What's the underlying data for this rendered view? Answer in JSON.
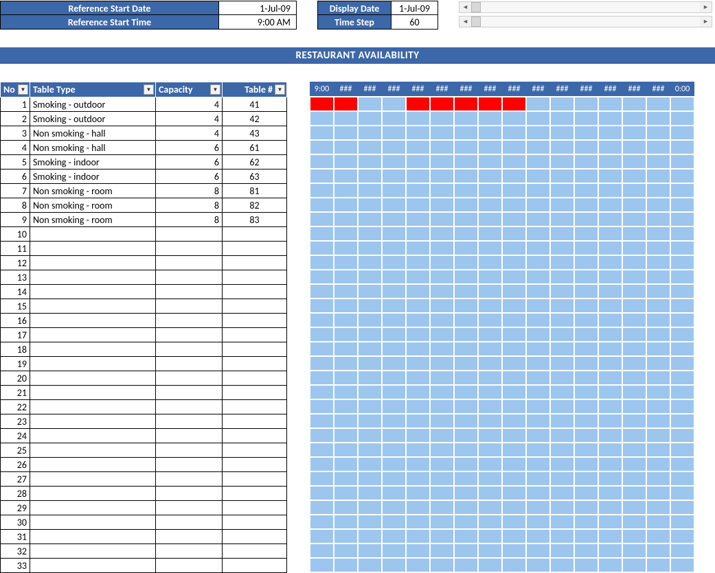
{
  "header": {
    "ref_start_date_label": "Reference Start Date",
    "ref_start_date_value": "1-Jul-09",
    "ref_start_time_label": "Reference Start Time",
    "ref_start_time_value": "9:00 AM",
    "display_date_label": "Display Date",
    "display_date_value": "1-Jul-09",
    "time_step_label": "Time Step",
    "time_step_value": "60"
  },
  "title": "RESTAURANT AVAILABILITY",
  "table": {
    "headers": {
      "no": "No",
      "table_type": "Table Type",
      "capacity": "Capacity",
      "table_num": "Table #"
    },
    "rows": [
      {
        "no": "1",
        "type": "Smoking - outdoor",
        "cap": "4",
        "num": "41"
      },
      {
        "no": "2",
        "type": "Smoking - outdoor",
        "cap": "4",
        "num": "42"
      },
      {
        "no": "3",
        "type": "Non smoking - hall",
        "cap": "4",
        "num": "43"
      },
      {
        "no": "4",
        "type": "Non smoking - hall",
        "cap": "6",
        "num": "61"
      },
      {
        "no": "5",
        "type": "Smoking - indoor",
        "cap": "6",
        "num": "62"
      },
      {
        "no": "6",
        "type": "Smoking - indoor",
        "cap": "6",
        "num": "63"
      },
      {
        "no": "7",
        "type": "Non smoking - room",
        "cap": "8",
        "num": "81"
      },
      {
        "no": "8",
        "type": "Non smoking - room",
        "cap": "8",
        "num": "82"
      },
      {
        "no": "9",
        "type": "Non smoking - room",
        "cap": "8",
        "num": "83"
      },
      {
        "no": "10",
        "type": "",
        "cap": "",
        "num": ""
      },
      {
        "no": "11",
        "type": "",
        "cap": "",
        "num": ""
      },
      {
        "no": "12",
        "type": "",
        "cap": "",
        "num": ""
      },
      {
        "no": "13",
        "type": "",
        "cap": "",
        "num": ""
      },
      {
        "no": "14",
        "type": "",
        "cap": "",
        "num": ""
      },
      {
        "no": "15",
        "type": "",
        "cap": "",
        "num": ""
      },
      {
        "no": "16",
        "type": "",
        "cap": "",
        "num": ""
      },
      {
        "no": "17",
        "type": "",
        "cap": "",
        "num": ""
      },
      {
        "no": "18",
        "type": "",
        "cap": "",
        "num": ""
      },
      {
        "no": "19",
        "type": "",
        "cap": "",
        "num": ""
      },
      {
        "no": "20",
        "type": "",
        "cap": "",
        "num": ""
      },
      {
        "no": "21",
        "type": "",
        "cap": "",
        "num": ""
      },
      {
        "no": "22",
        "type": "",
        "cap": "",
        "num": ""
      },
      {
        "no": "23",
        "type": "",
        "cap": "",
        "num": ""
      },
      {
        "no": "24",
        "type": "",
        "cap": "",
        "num": ""
      },
      {
        "no": "25",
        "type": "",
        "cap": "",
        "num": ""
      },
      {
        "no": "26",
        "type": "",
        "cap": "",
        "num": ""
      },
      {
        "no": "27",
        "type": "",
        "cap": "",
        "num": ""
      },
      {
        "no": "28",
        "type": "",
        "cap": "",
        "num": ""
      },
      {
        "no": "29",
        "type": "",
        "cap": "",
        "num": ""
      },
      {
        "no": "30",
        "type": "",
        "cap": "",
        "num": ""
      },
      {
        "no": "31",
        "type": "",
        "cap": "",
        "num": ""
      },
      {
        "no": "32",
        "type": "",
        "cap": "",
        "num": ""
      },
      {
        "no": "33",
        "type": "",
        "cap": "",
        "num": ""
      }
    ]
  },
  "grid": {
    "time_headers": [
      "9:00",
      "###",
      "###",
      "###",
      "###",
      "###",
      "###",
      "###",
      "###",
      "###",
      "###",
      "###",
      "###",
      "###",
      "###",
      "0:00"
    ],
    "num_rows": 33,
    "booked_cells": [
      {
        "row": 0,
        "col": 0
      },
      {
        "row": 0,
        "col": 1
      },
      {
        "row": 0,
        "col": 4
      },
      {
        "row": 0,
        "col": 5
      },
      {
        "row": 0,
        "col": 6
      },
      {
        "row": 0,
        "col": 7
      },
      {
        "row": 0,
        "col": 8
      }
    ]
  }
}
